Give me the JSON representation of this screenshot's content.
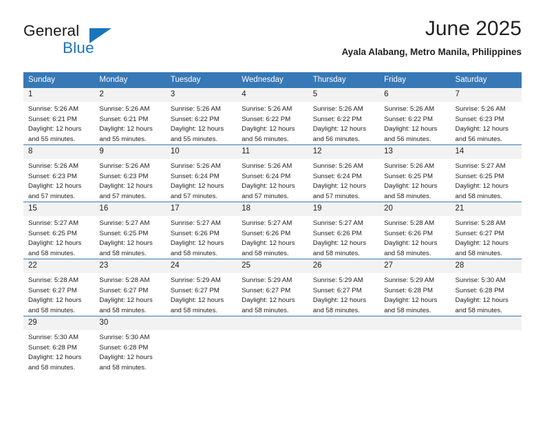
{
  "branding": {
    "name_part1": "General",
    "name_part2": "Blue",
    "accent_color": "#1b75bb"
  },
  "header": {
    "month_title": "June 2025",
    "location": "Ayala Alabang, Metro Manila, Philippines"
  },
  "calendar": {
    "header_bg": "#3778b6",
    "daynum_bg": "#f2f2f2",
    "weekday_headers": [
      "Sunday",
      "Monday",
      "Tuesday",
      "Wednesday",
      "Thursday",
      "Friday",
      "Saturday"
    ],
    "weeks": [
      [
        {
          "day": "1",
          "sunrise": "Sunrise: 5:26 AM",
          "sunset": "Sunset: 6:21 PM",
          "daylight_1": "Daylight: 12 hours",
          "daylight_2": "and 55 minutes."
        },
        {
          "day": "2",
          "sunrise": "Sunrise: 5:26 AM",
          "sunset": "Sunset: 6:21 PM",
          "daylight_1": "Daylight: 12 hours",
          "daylight_2": "and 55 minutes."
        },
        {
          "day": "3",
          "sunrise": "Sunrise: 5:26 AM",
          "sunset": "Sunset: 6:22 PM",
          "daylight_1": "Daylight: 12 hours",
          "daylight_2": "and 55 minutes."
        },
        {
          "day": "4",
          "sunrise": "Sunrise: 5:26 AM",
          "sunset": "Sunset: 6:22 PM",
          "daylight_1": "Daylight: 12 hours",
          "daylight_2": "and 56 minutes."
        },
        {
          "day": "5",
          "sunrise": "Sunrise: 5:26 AM",
          "sunset": "Sunset: 6:22 PM",
          "daylight_1": "Daylight: 12 hours",
          "daylight_2": "and 56 minutes."
        },
        {
          "day": "6",
          "sunrise": "Sunrise: 5:26 AM",
          "sunset": "Sunset: 6:22 PM",
          "daylight_1": "Daylight: 12 hours",
          "daylight_2": "and 56 minutes."
        },
        {
          "day": "7",
          "sunrise": "Sunrise: 5:26 AM",
          "sunset": "Sunset: 6:23 PM",
          "daylight_1": "Daylight: 12 hours",
          "daylight_2": "and 56 minutes."
        }
      ],
      [
        {
          "day": "8",
          "sunrise": "Sunrise: 5:26 AM",
          "sunset": "Sunset: 6:23 PM",
          "daylight_1": "Daylight: 12 hours",
          "daylight_2": "and 57 minutes."
        },
        {
          "day": "9",
          "sunrise": "Sunrise: 5:26 AM",
          "sunset": "Sunset: 6:23 PM",
          "daylight_1": "Daylight: 12 hours",
          "daylight_2": "and 57 minutes."
        },
        {
          "day": "10",
          "sunrise": "Sunrise: 5:26 AM",
          "sunset": "Sunset: 6:24 PM",
          "daylight_1": "Daylight: 12 hours",
          "daylight_2": "and 57 minutes."
        },
        {
          "day": "11",
          "sunrise": "Sunrise: 5:26 AM",
          "sunset": "Sunset: 6:24 PM",
          "daylight_1": "Daylight: 12 hours",
          "daylight_2": "and 57 minutes."
        },
        {
          "day": "12",
          "sunrise": "Sunrise: 5:26 AM",
          "sunset": "Sunset: 6:24 PM",
          "daylight_1": "Daylight: 12 hours",
          "daylight_2": "and 57 minutes."
        },
        {
          "day": "13",
          "sunrise": "Sunrise: 5:26 AM",
          "sunset": "Sunset: 6:25 PM",
          "daylight_1": "Daylight: 12 hours",
          "daylight_2": "and 58 minutes."
        },
        {
          "day": "14",
          "sunrise": "Sunrise: 5:27 AM",
          "sunset": "Sunset: 6:25 PM",
          "daylight_1": "Daylight: 12 hours",
          "daylight_2": "and 58 minutes."
        }
      ],
      [
        {
          "day": "15",
          "sunrise": "Sunrise: 5:27 AM",
          "sunset": "Sunset: 6:25 PM",
          "daylight_1": "Daylight: 12 hours",
          "daylight_2": "and 58 minutes."
        },
        {
          "day": "16",
          "sunrise": "Sunrise: 5:27 AM",
          "sunset": "Sunset: 6:25 PM",
          "daylight_1": "Daylight: 12 hours",
          "daylight_2": "and 58 minutes."
        },
        {
          "day": "17",
          "sunrise": "Sunrise: 5:27 AM",
          "sunset": "Sunset: 6:26 PM",
          "daylight_1": "Daylight: 12 hours",
          "daylight_2": "and 58 minutes."
        },
        {
          "day": "18",
          "sunrise": "Sunrise: 5:27 AM",
          "sunset": "Sunset: 6:26 PM",
          "daylight_1": "Daylight: 12 hours",
          "daylight_2": "and 58 minutes."
        },
        {
          "day": "19",
          "sunrise": "Sunrise: 5:27 AM",
          "sunset": "Sunset: 6:26 PM",
          "daylight_1": "Daylight: 12 hours",
          "daylight_2": "and 58 minutes."
        },
        {
          "day": "20",
          "sunrise": "Sunrise: 5:28 AM",
          "sunset": "Sunset: 6:26 PM",
          "daylight_1": "Daylight: 12 hours",
          "daylight_2": "and 58 minutes."
        },
        {
          "day": "21",
          "sunrise": "Sunrise: 5:28 AM",
          "sunset": "Sunset: 6:27 PM",
          "daylight_1": "Daylight: 12 hours",
          "daylight_2": "and 58 minutes."
        }
      ],
      [
        {
          "day": "22",
          "sunrise": "Sunrise: 5:28 AM",
          "sunset": "Sunset: 6:27 PM",
          "daylight_1": "Daylight: 12 hours",
          "daylight_2": "and 58 minutes."
        },
        {
          "day": "23",
          "sunrise": "Sunrise: 5:28 AM",
          "sunset": "Sunset: 6:27 PM",
          "daylight_1": "Daylight: 12 hours",
          "daylight_2": "and 58 minutes."
        },
        {
          "day": "24",
          "sunrise": "Sunrise: 5:29 AM",
          "sunset": "Sunset: 6:27 PM",
          "daylight_1": "Daylight: 12 hours",
          "daylight_2": "and 58 minutes."
        },
        {
          "day": "25",
          "sunrise": "Sunrise: 5:29 AM",
          "sunset": "Sunset: 6:27 PM",
          "daylight_1": "Daylight: 12 hours",
          "daylight_2": "and 58 minutes."
        },
        {
          "day": "26",
          "sunrise": "Sunrise: 5:29 AM",
          "sunset": "Sunset: 6:27 PM",
          "daylight_1": "Daylight: 12 hours",
          "daylight_2": "and 58 minutes."
        },
        {
          "day": "27",
          "sunrise": "Sunrise: 5:29 AM",
          "sunset": "Sunset: 6:28 PM",
          "daylight_1": "Daylight: 12 hours",
          "daylight_2": "and 58 minutes."
        },
        {
          "day": "28",
          "sunrise": "Sunrise: 5:30 AM",
          "sunset": "Sunset: 6:28 PM",
          "daylight_1": "Daylight: 12 hours",
          "daylight_2": "and 58 minutes."
        }
      ],
      [
        {
          "day": "29",
          "sunrise": "Sunrise: 5:30 AM",
          "sunset": "Sunset: 6:28 PM",
          "daylight_1": "Daylight: 12 hours",
          "daylight_2": "and 58 minutes."
        },
        {
          "day": "30",
          "sunrise": "Sunrise: 5:30 AM",
          "sunset": "Sunset: 6:28 PM",
          "daylight_1": "Daylight: 12 hours",
          "daylight_2": "and 58 minutes."
        },
        {
          "day": "",
          "sunrise": "",
          "sunset": "",
          "daylight_1": "",
          "daylight_2": ""
        },
        {
          "day": "",
          "sunrise": "",
          "sunset": "",
          "daylight_1": "",
          "daylight_2": ""
        },
        {
          "day": "",
          "sunrise": "",
          "sunset": "",
          "daylight_1": "",
          "daylight_2": ""
        },
        {
          "day": "",
          "sunrise": "",
          "sunset": "",
          "daylight_1": "",
          "daylight_2": ""
        },
        {
          "day": "",
          "sunrise": "",
          "sunset": "",
          "daylight_1": "",
          "daylight_2": ""
        }
      ]
    ]
  }
}
